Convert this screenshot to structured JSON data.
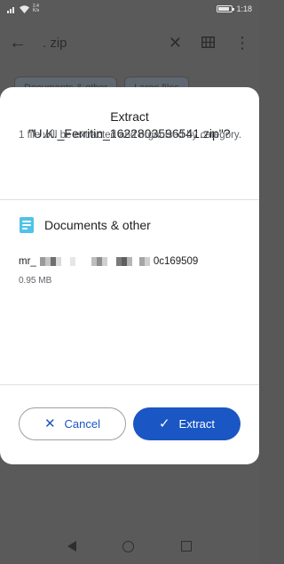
{
  "status_bar": {
    "net_rate_top": "2.4",
    "net_rate_bottom": "K/s",
    "battery_level": 0.85,
    "time": "1:18"
  },
  "app_bar": {
    "back_icon": "arrow-back-icon",
    "search_text": ". zip",
    "clear_icon": "close-icon",
    "view_icon": "grid-view-icon",
    "more_icon": "more-vert-icon"
  },
  "chips": [
    {
      "label": "Documents & other"
    },
    {
      "label": "Large files"
    }
  ],
  "dialog": {
    "title_line1": "Extract",
    "title_line2": "\"U.K._Ferritin_1622803596541.zip\"?",
    "message": "1 file will be extracted and organised by category.",
    "category": {
      "icon": "document-icon",
      "label": "Documents & other"
    },
    "file": {
      "name_prefix": "mr_",
      "name_suffix": "0c169509",
      "size": "0.95 MB"
    },
    "cancel_label": "Cancel",
    "extract_label": "Extract"
  },
  "colors": {
    "accent": "#1a56c4",
    "doc_icon": "#4fc3e8",
    "scrim": "#5a5a5a"
  }
}
